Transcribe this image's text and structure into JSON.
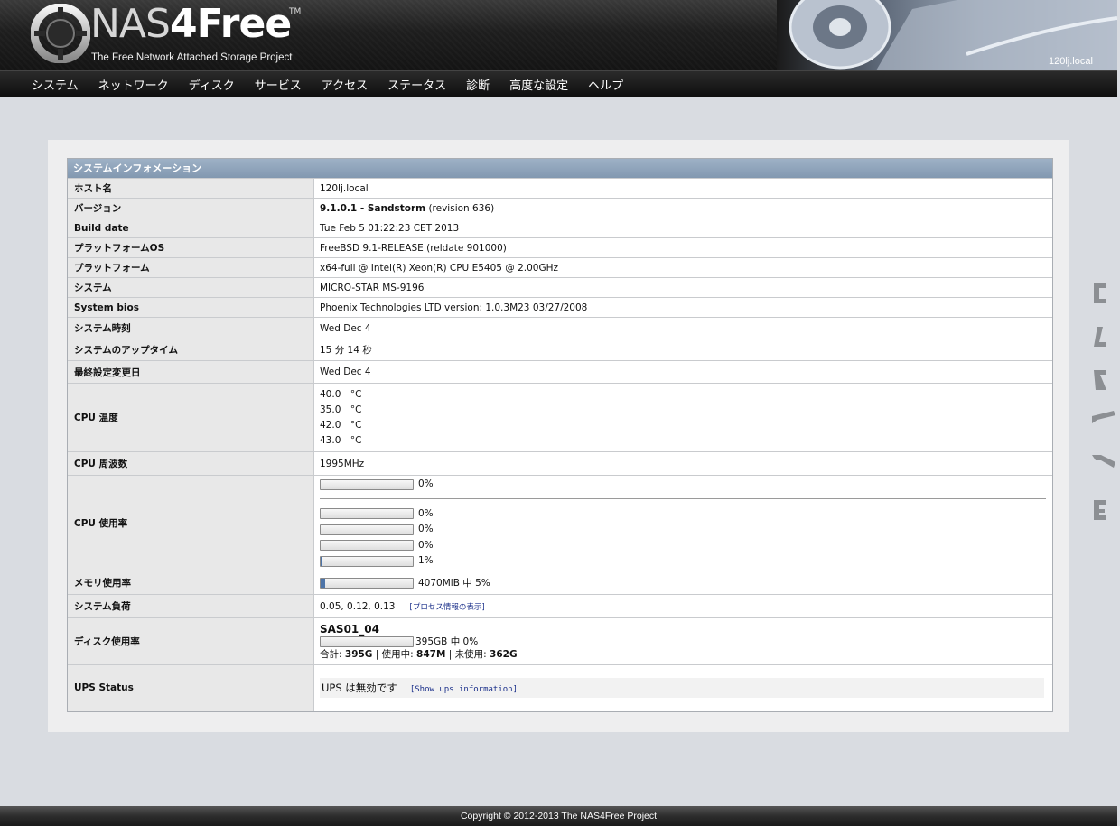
{
  "header": {
    "logo_nas": "NAS",
    "logo_four": "4Free",
    "logo_tm": "TM",
    "tagline": "The Free Network Attached Storage Project",
    "hostname": "120lj.local"
  },
  "nav": [
    "システム",
    "ネットワーク",
    "ディスク",
    "サービス",
    "アクセス",
    "ステータス",
    "診断",
    "高度な設定",
    "ヘルプ"
  ],
  "table_title": "システムインフォメーション",
  "rows": {
    "hostname": {
      "label": "ホスト名",
      "value": "120lj.local"
    },
    "version": {
      "label": "バージョン",
      "value_bold": "9.1.0.1 - Sandstorm",
      "value_rest": " (revision 636)"
    },
    "build_date": {
      "label": "Build date",
      "value": "Tue Feb 5 01:22:23 CET 2013"
    },
    "platform_os": {
      "label": "プラットフォームOS",
      "value": "FreeBSD 9.1-RELEASE (reldate 901000)"
    },
    "platform": {
      "label": "プラットフォーム",
      "value": "x64-full @ Intel(R) Xeon(R) CPU E5405 @ 2.00GHz"
    },
    "system": {
      "label": "システム",
      "value": "MICRO-STAR MS-9196"
    },
    "bios": {
      "label": "System bios",
      "value": "Phoenix Technologies LTD version: 1.0.3M23 03/27/2008"
    },
    "system_time": {
      "label": "システム時刻",
      "value": "Wed Dec  4"
    },
    "uptime": {
      "label": "システムのアップタイム",
      "value": "15 分 14 秒"
    },
    "last_change": {
      "label": "最終設定変更日",
      "value": "Wed Dec 4"
    },
    "cpu_temp": {
      "label": "CPU 温度",
      "values": [
        "40.0　°C",
        "35.0　°C",
        "42.0　°C",
        "43.0　°C"
      ]
    },
    "cpu_freq": {
      "label": "CPU 周波数",
      "value": "1995MHz"
    },
    "cpu_usage": {
      "label": "CPU 使用率",
      "total": {
        "percent": 0,
        "text": "0%"
      },
      "cores": [
        {
          "percent": 0,
          "text": "0%"
        },
        {
          "percent": 0,
          "text": "0%"
        },
        {
          "percent": 0,
          "text": "0%"
        },
        {
          "percent": 1,
          "text": "1%"
        }
      ]
    },
    "memory": {
      "label": "メモリ使用率",
      "percent": 5,
      "text": "4070MiB 中 5%"
    },
    "load": {
      "label": "システム負荷",
      "value": "0.05, 0.12, 0.13",
      "link": "[プロセス情報の表示]"
    },
    "disk": {
      "label": "ディスク使用率",
      "name": "SAS01_04",
      "percent": 0,
      "text": "395GB 中 0%",
      "total_label": "合計:",
      "total": "395G",
      "used_label": "| 使用中:",
      "used": "847M",
      "free_label": "| 未使用:",
      "free": "362G"
    },
    "ups": {
      "label": "UPS Status",
      "value": "UPS は無効です",
      "link": "[Show ups information]"
    }
  },
  "footer": "Copyright © 2012-2013 The NAS4Free Project",
  "colors": {
    "accent": "#8298b0",
    "bar_fill": "#4d74a8",
    "link": "#1a2f8a"
  }
}
